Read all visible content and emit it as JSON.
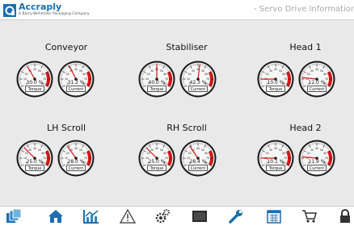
{
  "header": {
    "logo_name": "Accraply",
    "logo_tagline": "A Barry-Wehmiller Packaging Company",
    "page_title": "- Servo Drive Information"
  },
  "colors": {
    "brand": "#1c6fb0",
    "red_zone": "#e01414",
    "panel_bg": "#e9e9e9"
  },
  "stations": [
    {
      "title": "Conveyor",
      "gauges": [
        {
          "label": "Torque",
          "value_text": "30.0 %",
          "value": 30.0
        },
        {
          "label": "Current",
          "value_text": "31.2 %",
          "value": 31.2
        }
      ]
    },
    {
      "title": "Stabiliser",
      "gauges": [
        {
          "label": "Torque",
          "value_text": "40.0 %",
          "value": 40.0
        },
        {
          "label": "Current",
          "value_text": "42.3 %",
          "value": 42.3
        }
      ]
    },
    {
      "title": "Head 1",
      "gauges": [
        {
          "label": "Torque",
          "value_text": "10.0 %",
          "value": 10.0
        },
        {
          "label": "Current",
          "value_text": "12.0 %",
          "value": 12.0
        }
      ]
    },
    {
      "title": "LH Scroll",
      "gauges": [
        {
          "label": "Torque",
          "value_text": "25.0 %",
          "value": 25.0
        },
        {
          "label": "Current",
          "value_text": "28.0 %",
          "value": 28.0
        }
      ]
    },
    {
      "title": "RH Scroll",
      "gauges": [
        {
          "label": "Torque",
          "value_text": "25.0 %",
          "value": 25.0
        },
        {
          "label": "Current",
          "value_text": "28.4 %",
          "value": 28.4
        }
      ]
    },
    {
      "title": "Head 2",
      "gauges": [
        {
          "label": "Torque",
          "value_text": "10.1 %",
          "value": 10.1
        },
        {
          "label": "Current",
          "value_text": "11.9 %",
          "value": 11.9
        }
      ]
    }
  ],
  "gauge_scale": {
    "min": 0,
    "max": 80,
    "red_from": 60
  },
  "nav": [
    {
      "name": "screens-icon"
    },
    {
      "name": "home-icon"
    },
    {
      "name": "trend-chart-icon"
    },
    {
      "name": "alarm-warning-icon"
    },
    {
      "name": "settings-gears-icon"
    },
    {
      "name": "display-panel-icon"
    },
    {
      "name": "maintenance-wrench-icon"
    },
    {
      "name": "production-calendar-icon"
    },
    {
      "name": "cart-icon"
    },
    {
      "name": "lock-icon"
    }
  ]
}
